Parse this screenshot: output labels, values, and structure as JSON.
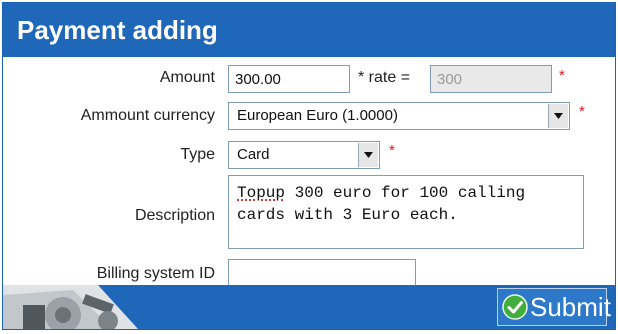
{
  "header": {
    "title": "Payment adding"
  },
  "form": {
    "amount": {
      "label": "Amount",
      "value": "300.00"
    },
    "rate": {
      "label": "* rate =",
      "value": "300"
    },
    "currency": {
      "label": "Ammount currency",
      "selected": "European Euro (1.0000)"
    },
    "type": {
      "label": "Type",
      "selected": "Card"
    },
    "description": {
      "label": "Description",
      "first_word": "Topup",
      "rest_line1": " 300 euro for 100 calling",
      "line2": "cards with 3 Euro each."
    },
    "billing_id": {
      "label": "Billing system ID",
      "value": ""
    },
    "required_mark": "*"
  },
  "footer": {
    "submit_label": "Submit"
  },
  "colors": {
    "brand_blue": "#1f67b8",
    "required_red": "#e3161a"
  },
  "icons": [
    "chevron-down-icon",
    "checkmark-icon",
    "gear-machine-graphic"
  ]
}
